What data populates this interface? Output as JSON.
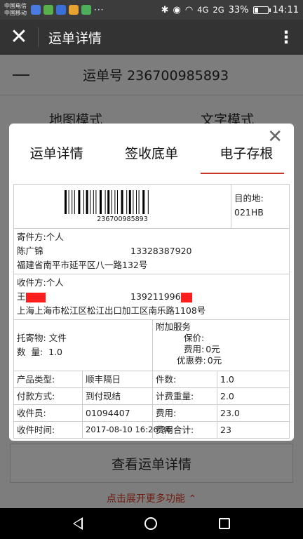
{
  "status_bar": {
    "carrier1": "中国电信",
    "carrier2": "中国移动",
    "apps": [
      {
        "icon": "app-icon-1",
        "color": "#4a7be0"
      },
      {
        "icon": "app-icon-2",
        "color": "#58b04a"
      },
      {
        "icon": "app-icon-3",
        "color": "#3a6fd8"
      },
      {
        "icon": "app-icon-4",
        "color": "#e8a230"
      },
      {
        "icon": "app-icon-5",
        "color": "#4fae5c"
      }
    ],
    "more": "···",
    "bluetooth": "✱",
    "signal_4g": "4G",
    "signal_2g": "2G",
    "battery_percent": "33%",
    "battery_level": 0.33,
    "time": "14:11"
  },
  "app_bar": {
    "close_icon": "✕",
    "title": "运单详情",
    "more_icon": "⋮"
  },
  "background": {
    "waybill_label": "运单号 236700985893",
    "mode_map": "地图模式",
    "mode_text": "文字模式",
    "detail_button": "查看运单详情",
    "expand_more": "点击展开更多功能 ⌃"
  },
  "modal": {
    "close_icon": "✕",
    "tabs": [
      {
        "label": "运单详情",
        "active": false
      },
      {
        "label": "签收底单",
        "active": false
      },
      {
        "label": "电子存根",
        "active": true
      }
    ],
    "receipt": {
      "barcode_number": "236700985893",
      "destination_label": "目的地:",
      "destination_value": "021HB",
      "sender_label": "寄件方:",
      "sender_type": "个人",
      "sender_name": "陈广锦",
      "sender_phone": "13328387920",
      "sender_address": "福建省南平市延平区八一路132号",
      "receiver_label": "收件方:",
      "receiver_type": "个人",
      "receiver_name": "王",
      "receiver_phone": "139211996",
      "receiver_address": "上海上海市松江区松江出口加工区南乐路1108号",
      "goods_label": "托寄物:",
      "goods_value": "文件",
      "qty_label": "数  量:",
      "qty_value": "1.0",
      "extra_service_label": "附加服务",
      "insure_label": "保价:",
      "insure_value": "",
      "fee_label": "费用:",
      "fee_value": "0元",
      "coupon_label": "优惠券:",
      "coupon_value": "0元",
      "grid": [
        {
          "k1": "产品类型:",
          "v1": "顺丰隔日",
          "k2": "件数:",
          "v2": "1.0"
        },
        {
          "k1": "付款方式:",
          "v1": "到付现结",
          "k2": "计费重量:",
          "v2": "2.0"
        },
        {
          "k1": "收件员:",
          "v1": "01094407",
          "k2": "费用:",
          "v2": "23.0"
        },
        {
          "k1": "收件时间:",
          "v1": "2017-08-10 16:26:36",
          "k2": "费用合计:",
          "v2": "23"
        }
      ]
    }
  },
  "colors": {
    "accent": "#c8352b",
    "redaction": "#ff1e1e"
  }
}
